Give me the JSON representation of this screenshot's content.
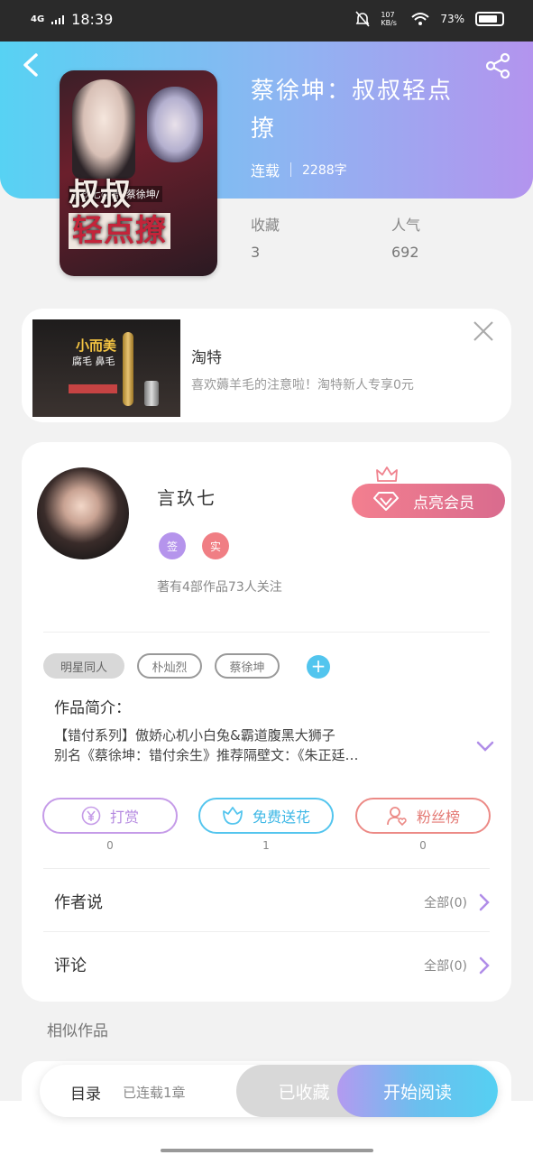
{
  "status_bar": {
    "network": "4G",
    "time": "18:39",
    "speed": "107 KB/s",
    "battery": "73%"
  },
  "book": {
    "title": "蔡徐坤：叔叔轻点撩",
    "status": "连载",
    "word_count": "2288字",
    "cover_title_line1": "叔叔",
    "cover_title_line2": "轻点撩",
    "cover_byline": "言玖七◎著 /蔡徐坤/",
    "stats": [
      {
        "label": "收藏",
        "value": "3"
      },
      {
        "label": "人气",
        "value": "692"
      }
    ]
  },
  "ad": {
    "image_badge": "小而美",
    "image_sub": "腐毛 鼻毛",
    "name": "淘特",
    "desc": "喜欢薅羊毛的注意啦！淘特新人专享0元"
  },
  "author": {
    "name": "言玖七",
    "badges": [
      {
        "label": "签",
        "color": "#b594ec"
      },
      {
        "label": "实",
        "color": "#f07e84"
      }
    ],
    "stats": "著有4部作品73人关注",
    "vip_label": "点亮会员"
  },
  "tags": [
    "明星同人",
    "朴灿烈",
    "蔡徐坤"
  ],
  "intro": {
    "label": "作品简介：",
    "line1": "【错付系列】傲娇心机小白兔&霸道腹黑大狮子",
    "line2": "别名《蔡徐坤：错付余生》推荐隔壁文：《朱正廷…"
  },
  "actions": [
    {
      "label": "打赏",
      "count": "0",
      "color": "#c59be8",
      "icon": "yen-icon"
    },
    {
      "label": "免费送花",
      "count": "1",
      "color": "#54c5ee",
      "icon": "flower-icon"
    },
    {
      "label": "粉丝榜",
      "count": "0",
      "color": "#ec8a86",
      "icon": "fan-icon"
    }
  ],
  "rows": [
    {
      "label": "作者说",
      "all": "全部(0)"
    },
    {
      "label": "评论",
      "all": "全部(0)"
    }
  ],
  "similar_label": "相似作品",
  "bottom_bar": {
    "toc": "目录",
    "serial": "已连载1章",
    "collected": "已收藏",
    "start": "开始阅读"
  }
}
